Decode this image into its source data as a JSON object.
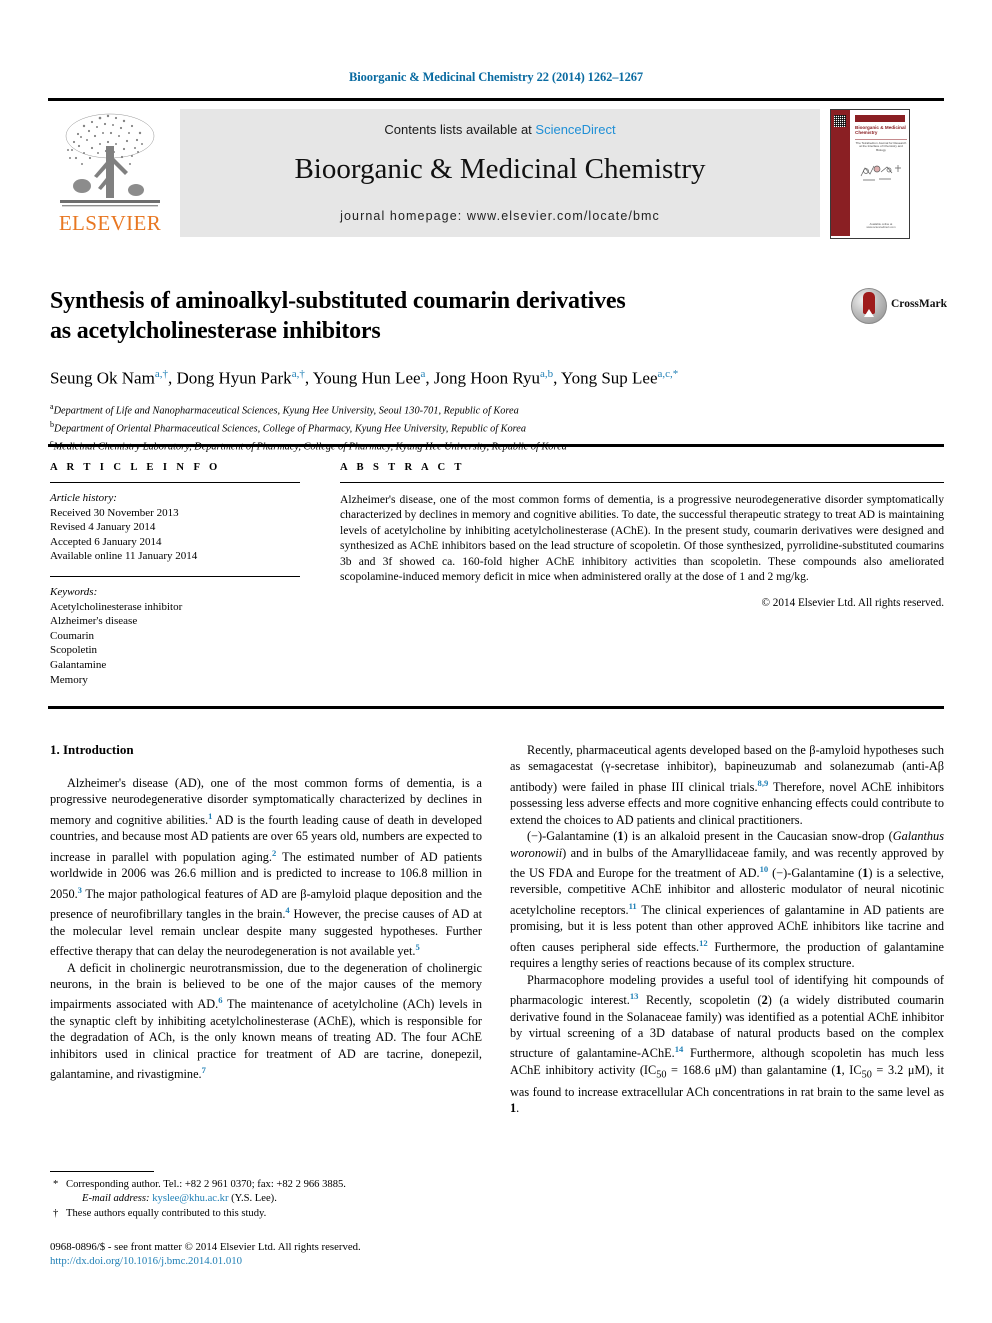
{
  "running_head": "Bioorganic & Medicinal Chemistry 22 (2014) 1262–1267",
  "masthead": {
    "contents_prefix": "Contents lists available at ",
    "sciencedirect": "ScienceDirect",
    "journal_title": "Bioorganic & Medicinal Chemistry",
    "homepage": "journal homepage: www.elsevier.com/locate/bmc",
    "publisher": "ELSEVIER",
    "cover": {
      "title": "Bioorganic & Medicinal Chemistry",
      "subtitle": "The Tetrahedron Journal for Research at the Interface of Chemistry and Biology",
      "footer": "Available online at www.sciencedirect.com"
    }
  },
  "title": {
    "line1": "Synthesis of aminoalkyl-substituted coumarin derivatives",
    "line2": "as acetylcholinesterase inhibitors"
  },
  "crossmark": {
    "label": "CrossMark"
  },
  "authors": [
    {
      "name": "Seung Ok Nam",
      "sup": "a,†",
      "sep": ", "
    },
    {
      "name": "Dong Hyun Park",
      "sup": "a,†",
      "sep": ", "
    },
    {
      "name": "Young Hun Lee",
      "sup": "a",
      "sep": ", "
    },
    {
      "name": "Jong Hoon Ryu",
      "sup": "a,b",
      "sep": ", "
    },
    {
      "name": "Yong Sup Lee",
      "sup": "a,c,*",
      "sep": ""
    }
  ],
  "affiliations": [
    {
      "mark": "a",
      "text": "Department of Life and Nanopharmaceutical Sciences, Kyung Hee University, Seoul 130-701, Republic of Korea"
    },
    {
      "mark": "b",
      "text": "Department of Oriental Pharmaceutical Sciences, College of Pharmacy, Kyung Hee University, Republic of Korea"
    },
    {
      "mark": "c",
      "text": "Medicinal Chemistry Laboratory, Department of Pharmacy, College of Pharmacy, Kyung Hee University, Republic of Korea"
    }
  ],
  "article_info": {
    "heading": "A R T I C L E   I N F O",
    "history_title": "Article history:",
    "history": [
      "Received 30 November 2013",
      "Revised 4 January 2014",
      "Accepted 6 January 2014",
      "Available online 11 January 2014"
    ],
    "keywords_title": "Keywords:",
    "keywords": [
      "Acetylcholinesterase inhibitor",
      "Alzheimer's disease",
      "Coumarin",
      "Scopoletin",
      "Galantamine",
      "Memory"
    ]
  },
  "abstract": {
    "heading": "A B S T R A C T",
    "text": "Alzheimer's disease, one of the most common forms of dementia, is a progressive neurodegenerative disorder symptomatically characterized by declines in memory and cognitive abilities. To date, the successful therapeutic strategy to treat AD is maintaining levels of acetylcholine by inhibiting acetylcholinesterase (AChE). In the present study, coumarin derivatives were designed and synthesized as AChE inhibitors based on the lead structure of scopoletin. Of those synthesized, pyrrolidine-substituted coumarins 3b and 3f showed ca. 160-fold higher AChE inhibitory activities than scopoletin. These compounds also ameliorated scopolamine-induced memory deficit in mice when administered orally at the dose of 1 and 2 mg/kg.",
    "copyright": "© 2014 Elsevier Ltd. All rights reserved."
  },
  "body": {
    "section_heading": "1. Introduction",
    "left_paragraphs": [
      "Alzheimer's disease (AD), one of the most common forms of dementia, is a progressive neurodegenerative disorder symptomatically characterized by declines in memory and cognitive abilities.<sup class=\"ref\">1</sup> AD is the fourth leading cause of death in developed countries, and because most AD patients are over 65 years old, numbers are expected to increase in parallel with population aging.<sup class=\"ref\">2</sup> The estimated number of AD patients worldwide in 2006 was 26.6 million and is predicted to increase to 106.8 million in 2050.<sup class=\"ref\">3</sup> The major pathological features of AD are β-amyloid plaque deposition and the presence of neurofibrillary tangles in the brain.<sup class=\"ref\">4</sup> However, the precise causes of AD at the molecular level remain unclear despite many suggested hypotheses. Further effective therapy that can delay the neurodegeneration is not available yet.<sup class=\"ref\">5</sup>",
      "A deficit in cholinergic neurotransmission, due to the degeneration of cholinergic neurons, in the brain is believed to be one of the major causes of the memory impairments associated with AD.<sup class=\"ref\">6</sup> The maintenance of acetylcholine (ACh) levels in the synaptic cleft by inhibiting acetylcholinesterase (AChE), which is responsible for the degradation of ACh, is the only known means of treating AD. The four AChE inhibitors used in clinical practice for treatment of AD are tacrine, donepezil, galantamine, and rivastigmine.<sup class=\"ref\">7</sup>"
    ],
    "right_paragraphs": [
      "Recently, pharmaceutical agents developed based on the β-amyloid hypotheses such as semagacestat (γ-secretase inhibitor), bapineuzumab and solanezumab (anti-Aβ antibody) were failed in phase III clinical trials.<sup class=\"ref\">8,9</sup> Therefore, novel AChE inhibitors possessing less adverse effects and more cognitive enhancing effects could contribute to extend the choices to AD patients and clinical practitioners.",
      "(−)-Galantamine (<b>1</b>) is an alkaloid present in the Caucasian snow-drop (<i>Galanthus woronowii</i>) and in bulbs of the Amaryllidaceae family, and was recently approved by the US FDA and Europe for the treatment of AD.<sup class=\"ref\">10</sup> (−)-Galantamine (<b>1</b>) is a selective, reversible, competitive AChE inhibitor and allosteric modulator of neural nicotinic acetylcholine receptors.<sup class=\"ref\">11</sup> The clinical experiences of galantamine in AD patients are promising, but it is less potent than other approved AChE inhibitors like tacrine and often causes peripheral side effects.<sup class=\"ref\">12</sup> Furthermore, the production of galantamine requires a lengthy series of reactions because of its complex structure.",
      "Pharmacophore modeling provides a useful tool of identifying hit compounds of pharmacologic interest.<sup class=\"ref\">13</sup> Recently, scopoletin (<b>2</b>) (a widely distributed coumarin derivative found in the Solanaceae family) was identified as a potential AChE inhibitor by virtual screening of a 3D database of natural products based on the complex structure of galantamine-AChE.<sup class=\"ref\">14</sup> Furthermore, although scopoletin has much less AChE inhibitory activity (IC<sub>50</sub> = 168.6 μM) than galantamine (<b>1</b>, IC<sub>50</sub> = 3.2 μM), it was found to increase extracellular ACh concentrations in rat brain to the same level as <b>1</b>."
    ]
  },
  "footnotes": {
    "corresponding": "Corresponding author. Tel.: +82 2 961 0370; fax: +82 2 966 3885.",
    "email_label": "E-mail address:",
    "email": "kyslee@khu.ac.kr",
    "email_suffix": "(Y.S. Lee).",
    "equal_contribution": "These authors equally contributed to this study."
  },
  "copyright_block": {
    "issn_line": "0968-0896/$ - see front matter © 2014 Elsevier Ltd. All rights reserved.",
    "doi": "http://dx.doi.org/10.1016/j.bmc.2014.01.010"
  },
  "colors": {
    "link": "#1f7fb5",
    "sciencedirect": "#1f8fd6",
    "elsevier_orange": "#E87722",
    "cover_maroon": "#8a1f23",
    "band_gray": "#e6e6e6"
  }
}
